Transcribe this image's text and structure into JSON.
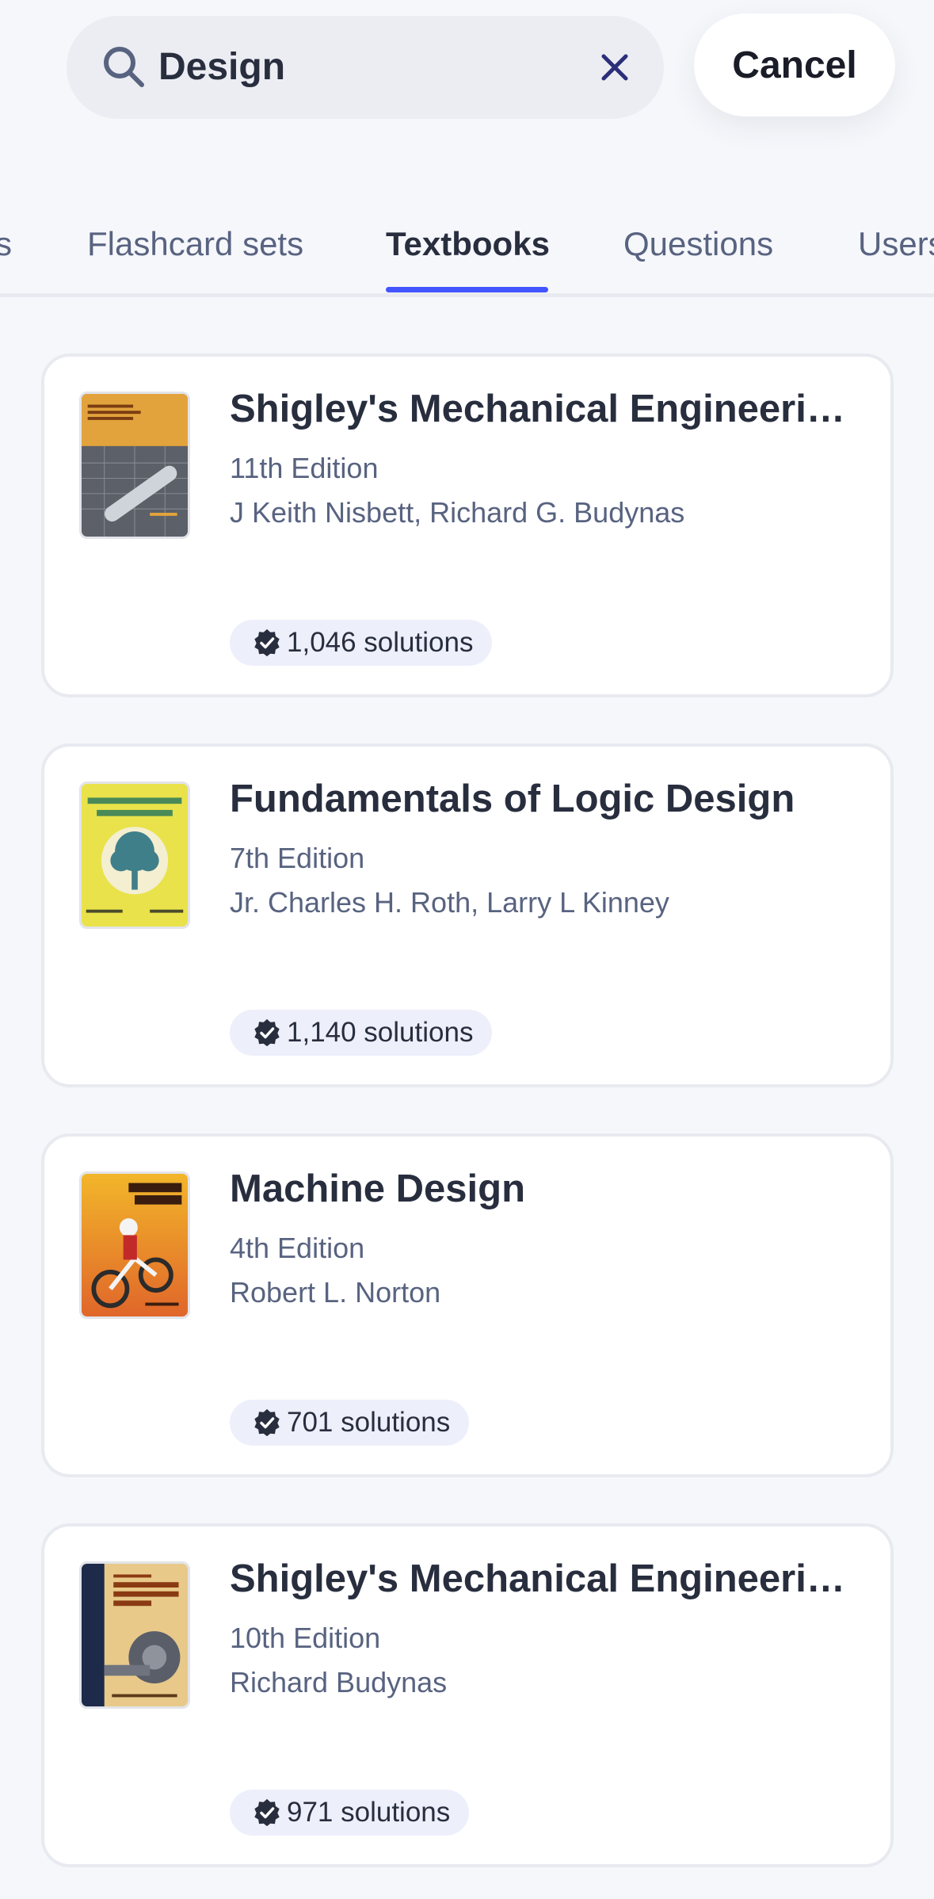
{
  "search": {
    "query": "Design",
    "cancel_label": "Cancel"
  },
  "tabs": [
    {
      "label": "s"
    },
    {
      "label": "Flashcard sets"
    },
    {
      "label": "Textbooks"
    },
    {
      "label": "Questions"
    },
    {
      "label": "Users"
    }
  ],
  "active_tab": "Textbooks",
  "colors": {
    "accent": "#4255ff",
    "background": "#f6f7fb",
    "text_primary": "#282e3e",
    "text_secondary": "#586380",
    "badge_background": "#edeffb"
  },
  "results": [
    {
      "title": "Shigley's Mechanical Engineering Design",
      "edition": "11th Edition",
      "authors": "J Keith Nisbett, Richard G. Budynas",
      "solutions": "1,046 solutions",
      "cover": "shigley-11e-cover"
    },
    {
      "title": "Fundamentals of Logic Design",
      "edition": "7th Edition",
      "authors": "Jr. Charles H. Roth, Larry L Kinney",
      "solutions": "1,140 solutions",
      "cover": "logic-design-cover"
    },
    {
      "title": "Machine Design",
      "edition": "4th Edition",
      "authors": "Robert L. Norton",
      "solutions": "701 solutions",
      "cover": "machine-design-cover"
    },
    {
      "title": "Shigley's Mechanical Engineering Design",
      "edition": "10th Edition",
      "authors": "Richard Budynas",
      "solutions": "971 solutions",
      "cover": "shigley-10e-cover"
    }
  ],
  "icons": {
    "search": "search-icon",
    "clear": "close-icon",
    "verified": "verified-badge-icon"
  }
}
